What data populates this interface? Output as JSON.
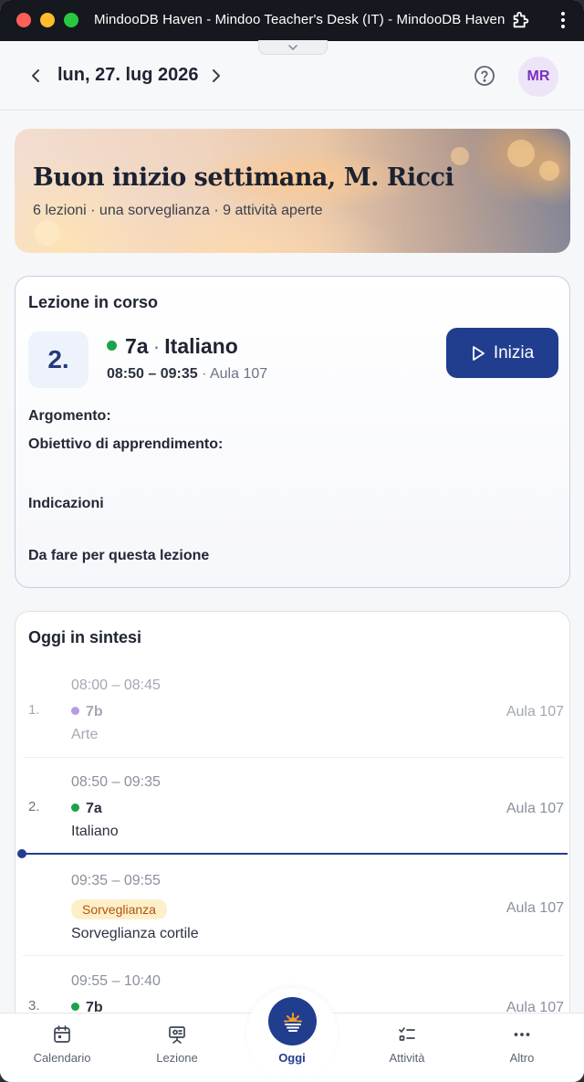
{
  "window": {
    "title": "MindooDB Haven - Mindoo Teacher's Desk (IT) - MindooDB Haven"
  },
  "header": {
    "date": "lun, 27. lug 2026",
    "avatar_initials": "MR"
  },
  "hero": {
    "greeting": "Buon inizio settimana, M. Ricci",
    "summary": "6 lezioni · una sorveglianza · 9 attività aperte"
  },
  "current_lesson": {
    "title": "Lezione in corso",
    "number": "2.",
    "class": "7a",
    "separator": "·",
    "subject": "Italiano",
    "time": "08:50 – 09:35",
    "room": "· Aula 107",
    "start_label": "Inizia",
    "fields": {
      "topic": "Argomento:",
      "objective": "Obiettivo di apprendimento:",
      "notes": "Indicazioni",
      "todo": "Da fare per questa lezione"
    },
    "class_color": "#1aa34a"
  },
  "summary": {
    "title": "Oggi in sintesi",
    "rows": [
      {
        "num": "1.",
        "time": "08:00 – 08:45",
        "class": "7b",
        "subject": "Arte",
        "room": "Aula 107",
        "dot_color": "#b69be6"
      },
      {
        "num": "2.",
        "time": "08:50 – 09:35",
        "class": "7a",
        "subject": "Italiano",
        "room": "Aula 107",
        "dot_color": "#1aa34a"
      },
      {
        "num": "",
        "time": "09:35 – 09:55",
        "badge": "Sorveglianza",
        "subject": "Sorveglianza cortile",
        "room": "Aula 107"
      },
      {
        "num": "3.",
        "time": "09:55 – 10:40",
        "class": "7b",
        "subject": "",
        "room": "Aula 107",
        "dot_color": "#1aa34a"
      }
    ]
  },
  "bottom_nav": {
    "calendar": "Calendario",
    "lesson": "Lezione",
    "today": "Oggi",
    "tasks": "Attività",
    "more": "Altro"
  },
  "colors": {
    "accent": "#213e8e",
    "badge_bg": "#fdf0c9",
    "badge_text": "#b4520d"
  }
}
